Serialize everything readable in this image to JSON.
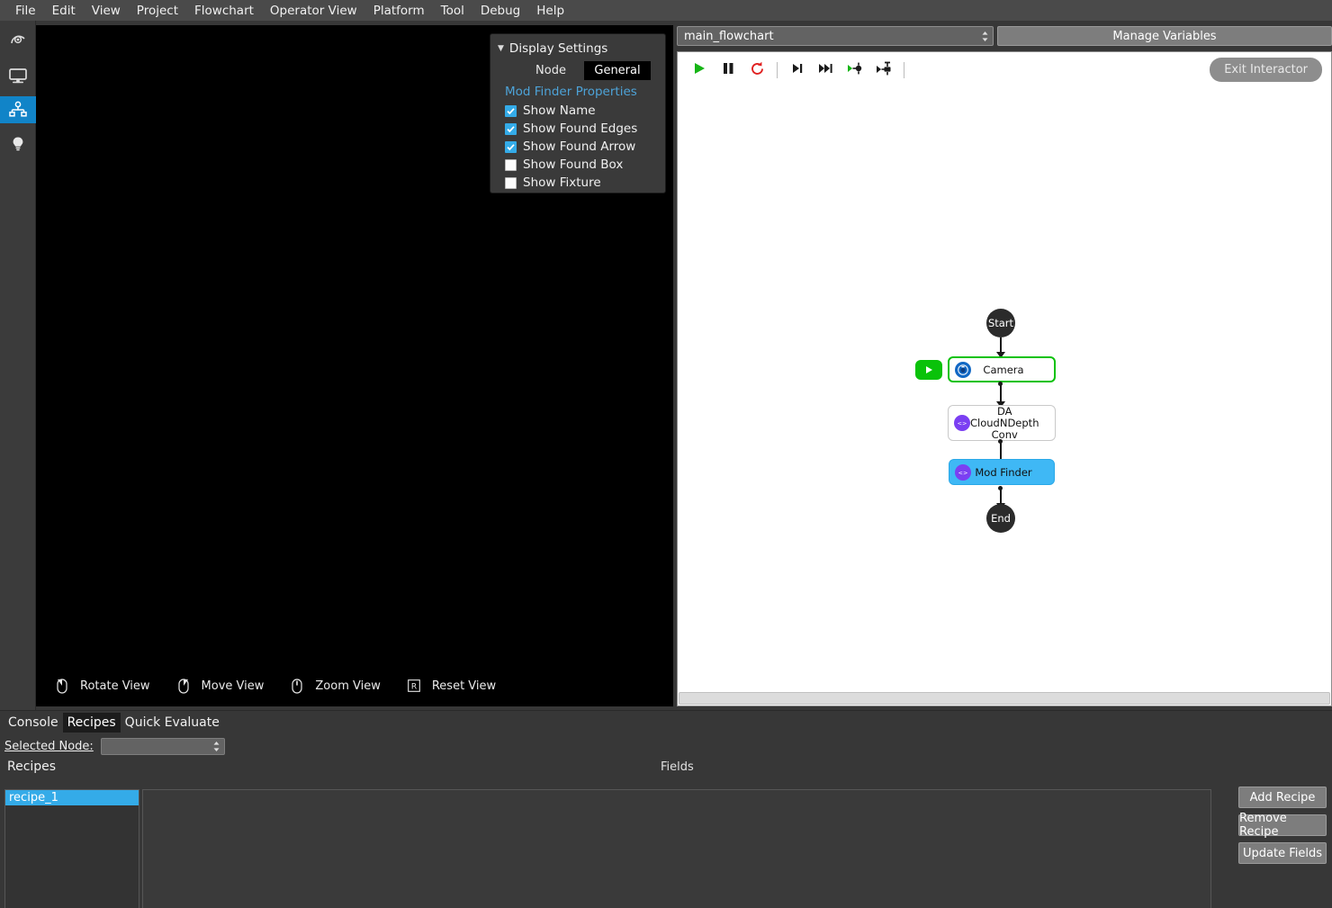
{
  "menu": {
    "items": [
      "File",
      "Edit",
      "View",
      "Project",
      "Flowchart",
      "Operator View",
      "Platform",
      "Tool",
      "Debug",
      "Help"
    ]
  },
  "sidebar": {
    "items": [
      {
        "name": "calibration-icon",
        "label": "Calibration",
        "active": false
      },
      {
        "name": "display-icon",
        "label": "Display",
        "active": false
      },
      {
        "name": "flowchart-tree-icon",
        "label": "Flowchart",
        "active": true
      },
      {
        "name": "lightbulb-icon",
        "label": "Lighting",
        "active": false
      }
    ]
  },
  "viewport": {
    "controls": [
      {
        "icon": "mouse-rotate-icon",
        "label": "Rotate View"
      },
      {
        "icon": "mouse-move-icon",
        "label": "Move View"
      },
      {
        "icon": "mouse-zoom-icon",
        "label": "Zoom View"
      },
      {
        "icon": "key-r-icon",
        "label": "Reset View"
      }
    ]
  },
  "display_settings": {
    "title": "Display Settings",
    "tabs": [
      {
        "label": "Node",
        "selected": false
      },
      {
        "label": "General",
        "selected": true
      }
    ],
    "section_title": "Mod Finder Properties",
    "checkboxes": [
      {
        "label": "Show Name",
        "checked": true
      },
      {
        "label": "Show Found Edges",
        "checked": true
      },
      {
        "label": "Show Found Arrow",
        "checked": true
      },
      {
        "label": "Show Found Box",
        "checked": false
      },
      {
        "label": "Show Fixture",
        "checked": false
      }
    ]
  },
  "flowchart": {
    "selected_chart": "main_flowchart",
    "manage_variables_label": "Manage Variables",
    "exit_label": "Exit Interactor",
    "toolbar": [
      {
        "name": "run-button",
        "icon": "play-icon"
      },
      {
        "name": "pause-button",
        "icon": "pause-icon"
      },
      {
        "name": "reload-button",
        "icon": "reload-icon"
      },
      {
        "name": "step-over-button",
        "icon": "step-icon"
      },
      {
        "name": "step-fast-button",
        "icon": "fast-forward-icon"
      },
      {
        "name": "run-to-node-button",
        "icon": "run-to-icon"
      },
      {
        "name": "run-from-node-button",
        "icon": "run-from-icon"
      }
    ],
    "nodes": [
      {
        "id": "start",
        "label": "Start",
        "type": "terminal"
      },
      {
        "id": "camera",
        "label": "Camera",
        "type": "process",
        "icon": "camera-icon",
        "state": "active"
      },
      {
        "id": "conv",
        "label": "DA CloudNDepth Conv",
        "type": "process",
        "icon": "code-icon",
        "state": "normal"
      },
      {
        "id": "modfinder",
        "label": "Mod Finder",
        "type": "process",
        "icon": "code-icon",
        "state": "selected"
      },
      {
        "id": "end",
        "label": "End",
        "type": "terminal"
      }
    ]
  },
  "bottom_panel": {
    "tabs": [
      {
        "label": "Console",
        "selected": false
      },
      {
        "label": "Recipes",
        "selected": true
      },
      {
        "label": "Quick Evaluate",
        "selected": false
      }
    ],
    "selected_node_label": "Selected Node:",
    "selected_node_value": "",
    "recipes_header": "Recipes",
    "fields_header": "Fields",
    "recipes": [
      "recipe_1"
    ],
    "buttons": [
      "Add Recipe",
      "Remove Recipe",
      "Update Fields"
    ]
  },
  "colors": {
    "accent_blue": "#34abe8",
    "node_green": "#0ac20a",
    "node_selected": "#3fb8f5",
    "icon_purple": "#7b3ff2",
    "icon_blue": "#1168c4",
    "reload_red": "#e02020"
  }
}
